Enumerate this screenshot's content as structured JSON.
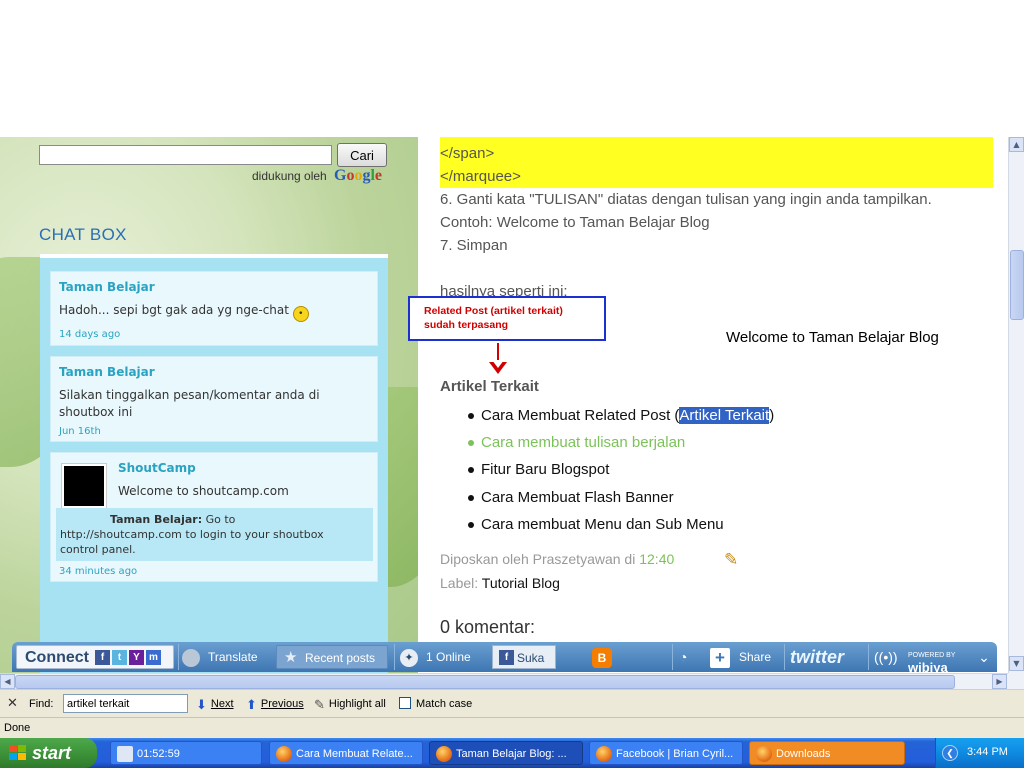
{
  "sidebar": {
    "search_button": "Cari",
    "powered_by": "didukung oleh",
    "google_letters": [
      "G",
      "o",
      "o",
      "g",
      "l",
      "e"
    ],
    "chat_title": "CHAT BOX",
    "messages": [
      {
        "author": "Taman Belajar",
        "text": "Hadoh... sepi bgt gak ada yg nge-chat",
        "ago": "14 days ago"
      },
      {
        "author": "Taman Belajar",
        "text1": "Silakan tinggalkan pesan/komentar anda di",
        "text2": "shoutbox ini",
        "ago": "Jun 16th"
      },
      {
        "author": "ShoutCamp",
        "text": "Welcome to shoutcamp.com",
        "reply_name": "Taman Belajar:",
        "reply_l1": "Go to",
        "reply_l2": "http://shoutcamp.com to login to your shoutbox",
        "reply_l3": "control panel.",
        "ago": "34 minutes ago"
      }
    ]
  },
  "content": {
    "code_lines": [
      "</span>",
      "</marquee>"
    ],
    "steps": [
      "6. Ganti kata \"TULISAN\" diatas dengan tulisan yang ingin anda tampilkan.",
      "Contoh: Welcome to Taman Belajar Blog",
      "7. Simpan"
    ],
    "result_label": "hasilnya seperti ini:",
    "annotation_line1": "Related Post (artikel terkait)",
    "annotation_line2": "sudah terpasang",
    "marquee_demo": "Welcome to Taman Belajar Blog",
    "related_title": "Artikel Terkait",
    "related_items": [
      {
        "pre": "Cara Membuat Related Post (",
        "sel": "Artikel Terkait",
        "post": ")"
      },
      {
        "label": "Cara membuat tulisan berjalan"
      },
      {
        "label": "Fitur Baru Blogspot"
      },
      {
        "label": "Cara Membuat Flash Banner"
      },
      {
        "label": "Cara membuat Menu dan Sub Menu"
      }
    ],
    "posted_by": "Diposkan oleh Praszetyawan di",
    "posted_time": "12:40",
    "label_prefix": "Label:",
    "label_value": "Tutorial Blog",
    "comments_title": "0 komentar:"
  },
  "toolbar": {
    "connect": "Connect",
    "translate": "Translate",
    "recent_posts": "Recent posts",
    "online": "1 Online",
    "suka": "Suka",
    "share": "Share",
    "twitter": "twitter",
    "powered": "POWERED BY",
    "wibiya": "wibiya"
  },
  "findbar": {
    "label": "Find:",
    "query": "artikel terkait",
    "next": "Next",
    "previous": "Previous",
    "highlight_all": "Highlight all",
    "match_case": "Match case"
  },
  "status": {
    "text": "Done"
  },
  "taskbar": {
    "start": "start",
    "clock_task": "01:52:59",
    "tasks": [
      "Cara Membuat Relate...",
      "Taman Belajar Blog: ...",
      "Facebook | Brian Cyril...",
      "Downloads"
    ],
    "time": "3:44 PM"
  },
  "colors": {
    "link_green": "#7cc25a",
    "highlight_yellow": "#ffff22",
    "selection_blue": "#3163c5",
    "annotation_red": "#d10000"
  }
}
